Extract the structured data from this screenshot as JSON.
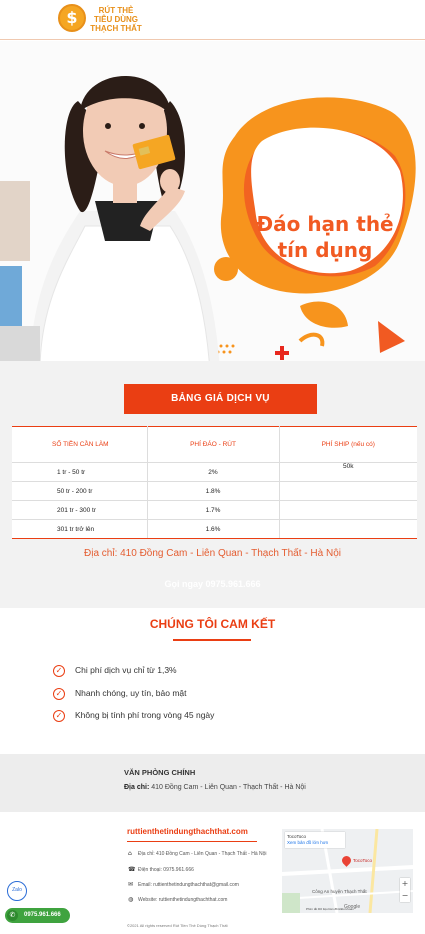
{
  "header": {
    "logo_text": "RÚT THẺ TIÊU DÙNG THẠCH THẤT",
    "logo_symbol": "$"
  },
  "hero": {
    "title": "Đáo hạn thẻ tín dụng",
    "colors": {
      "orange": "#f7941d",
      "deep_orange": "#f15a22"
    }
  },
  "pricing": {
    "button_label": "BẢNG GIÁ DỊCH VỤ",
    "columns": [
      "SỐ TIỀN CẦN LÀM",
      "PHÍ ĐÁO - RÚT",
      "PHÍ SHIP (nếu có)"
    ],
    "rows": [
      {
        "amount": "1 tr - 50 tr",
        "fee": "2%",
        "ship": "50k"
      },
      {
        "amount": "50 tr - 200 tr",
        "fee": "1.8%",
        "ship": ""
      },
      {
        "amount": "201 tr - 300 tr",
        "fee": "1.7%",
        "ship": ""
      },
      {
        "amount": "301 tr trở lên",
        "fee": "1.6%",
        "ship": ""
      }
    ],
    "address": "Địa chỉ: 410 Đồng Cam - Liên Quan - Thạch Thất - Hà Nội",
    "call": "Gọi ngay 0975.961.666"
  },
  "commitment": {
    "title": "CHÚNG TÔI CAM KẾT",
    "items": [
      "Chi phí dịch vụ chỉ từ 1,3%",
      "Nhanh chóng, uy tín, bảo mật",
      "Không bị tính phí trong vòng 45 ngày"
    ]
  },
  "office": {
    "title": "VĂN PHÒNG CHÍNH",
    "address_label": "Địa chỉ:",
    "address_value": "410 Đồng Cam - Liên Quan - Thạch Thất - Hà Nội"
  },
  "footer": {
    "site_name": "ruttienthetindungthachthat.com",
    "address": "Địa chỉ: 410 Đồng Cam - Liên Quan - Thạch Thất - Hà Nội",
    "phone": "Điện thoại: 0975.961.666",
    "email": "Email: ruttienthetindungthachthat@gmail.com",
    "website": "Website: ruttienthetindungthachthat.com",
    "copyright": "©2021 All rights reserved Rút Tiền Thẻ Dùng Thạch Thất"
  },
  "map": {
    "place_name": "TocoToco",
    "larger_map_link": "Xem bản đồ lớn hơn",
    "pin_label": "TocoToco",
    "nearby_label": "Công An huyện Thạch Thất",
    "google": "Google",
    "terms": "Phím tắt  Dữ liệu bản đồ  Điều khoản",
    "zoom_in": "+",
    "zoom_out": "−"
  },
  "floating": {
    "zalo_label": "Zalo",
    "phone": "0975.961.666"
  }
}
